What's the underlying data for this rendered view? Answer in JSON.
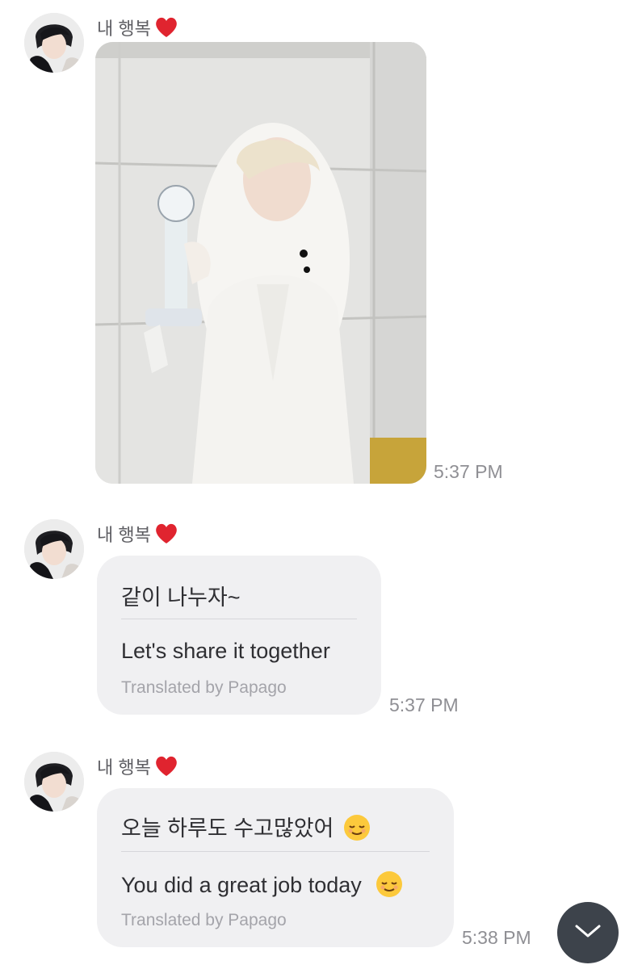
{
  "messages": [
    {
      "sender": "내 행복",
      "type": "photo",
      "time": "5:37 PM"
    },
    {
      "sender": "내 행복",
      "type": "text",
      "original": "같이 나누자~",
      "translation": "Let's share it together",
      "credit": "Translated by Papago",
      "time": "5:37 PM"
    },
    {
      "sender": "내 행복",
      "type": "text",
      "original": "오늘 하루도 수고많았어",
      "translation": "You did a great job today",
      "credit": "Translated by Papago",
      "time": "5:38 PM"
    }
  ],
  "icons": {
    "sender_badge": "red-heart-icon",
    "emoji": "relieved-face-icon",
    "scroll_button": "chevron-down-icon"
  },
  "colors": {
    "bubble": "#f0f0f2",
    "heart": "#e0242f",
    "scroll_button": "#3d434b"
  }
}
